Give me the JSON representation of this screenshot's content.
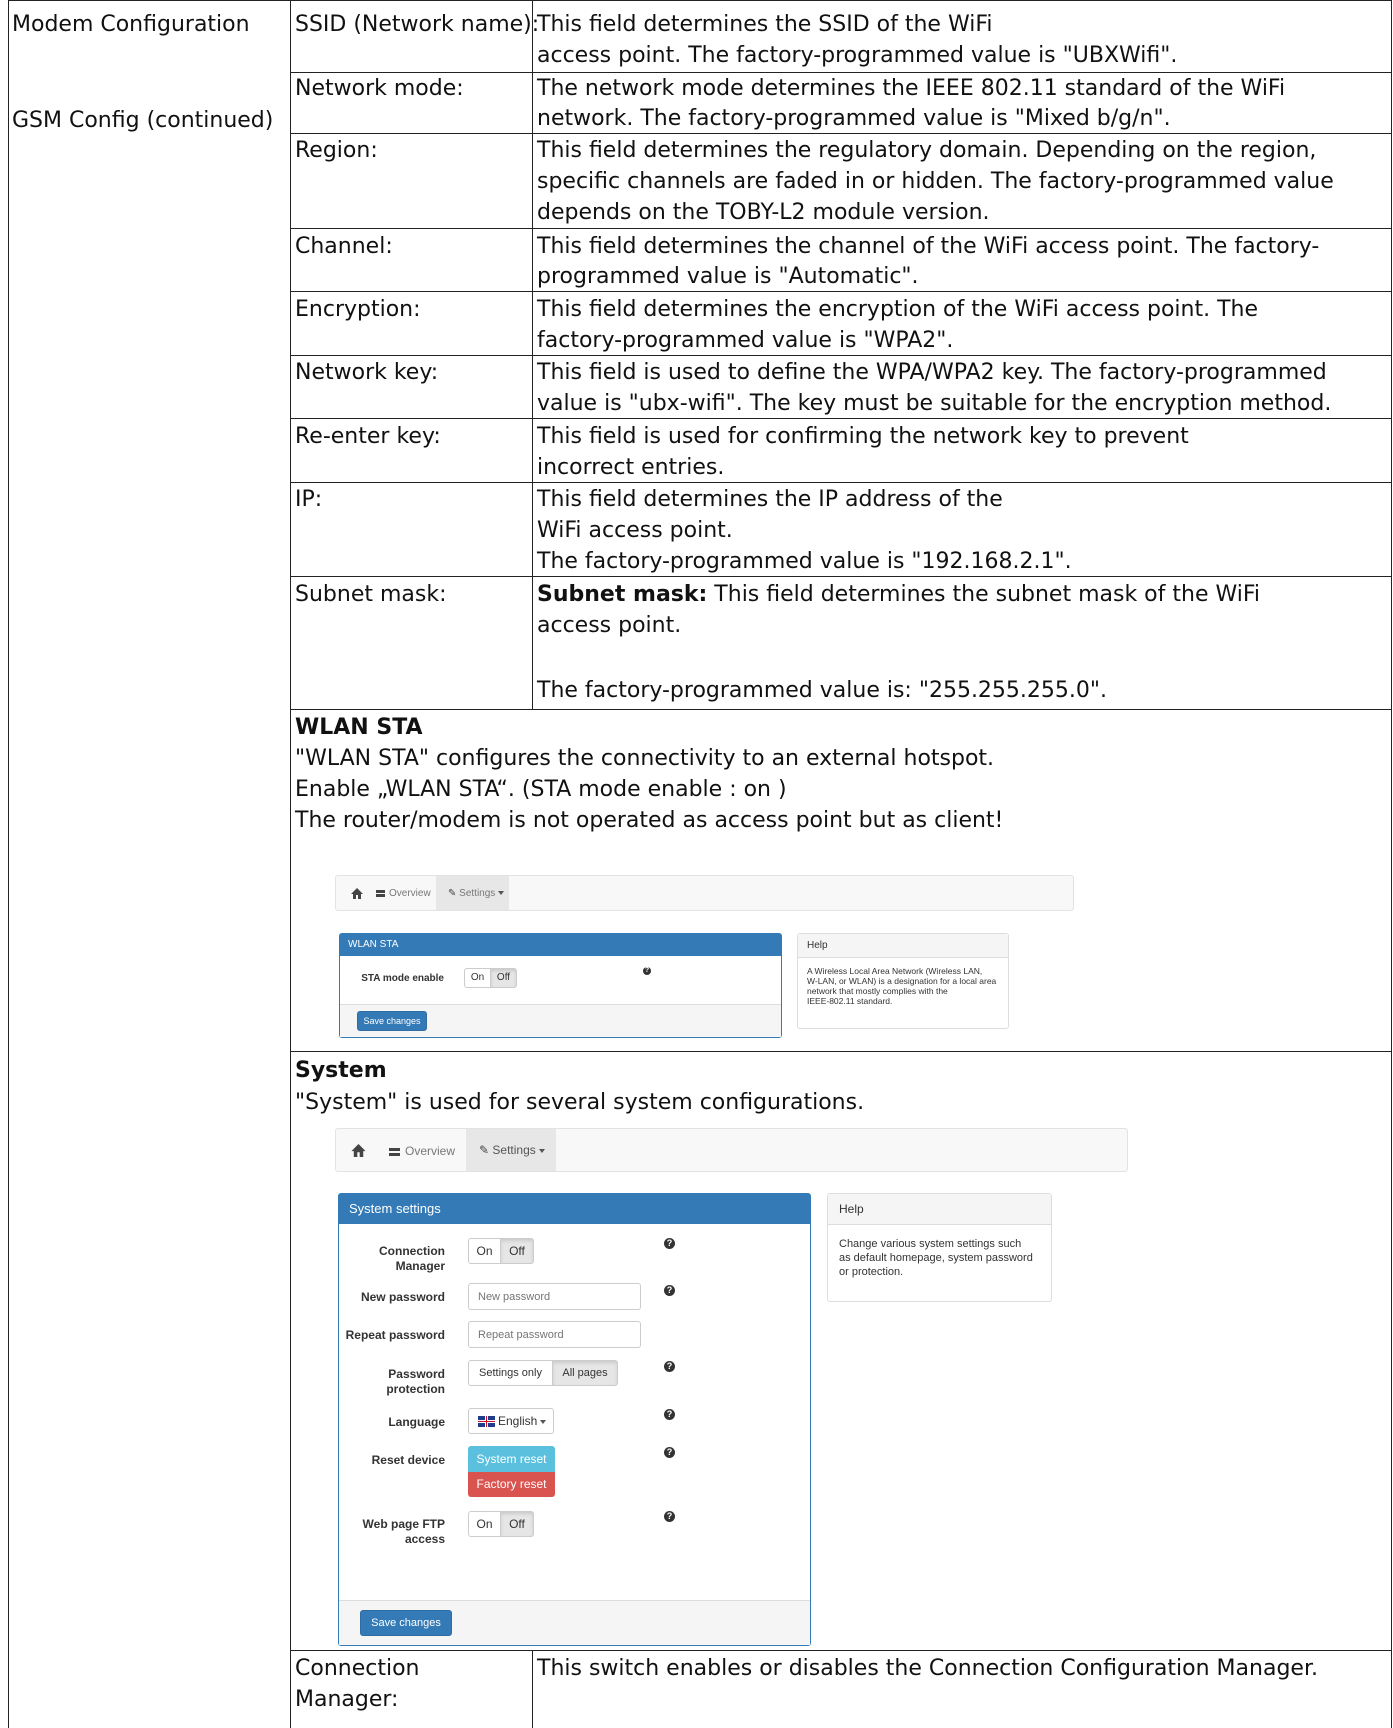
{
  "left_column": {
    "section": "Modem Configuration",
    "subsection": "GSM Config (continued)"
  },
  "wifi_rows": [
    {
      "label": "SSID (Network name):",
      "lines": [
        "This field determines the SSID of the WiFi",
        "access point. The factory-programmed value is \"UBXWifi\"."
      ]
    },
    {
      "label": "Network mode:",
      "lines": [
        "The network mode determines the IEEE 802.11 standard of the WiFi",
        "network. The factory-programmed value is \"Mixed b/g/n\"."
      ]
    },
    {
      "label": "Region:",
      "lines": [
        "This field determines the regulatory domain. Depending on the region,",
        "specific channels are faded in or hidden. The factory-programmed value",
        "depends on the TOBY-L2 module version."
      ]
    },
    {
      "label": "Channel:",
      "lines": [
        "This field determines the channel of the WiFi access point. The factory-",
        "programmed value is \"Automatic\"."
      ]
    },
    {
      "label": "Encryption:",
      "lines": [
        "This field determines the encryption of the WiFi access point. The",
        "factory-programmed value is \"WPA2\"."
      ]
    },
    {
      "label": "Network key:",
      "lines": [
        "This field is used to define the WPA/WPA2 key. The factory-programmed",
        "value is \"ubx-wifi\". The key must be suitable for the encryption method."
      ]
    },
    {
      "label": "Re-enter key:",
      "lines": [
        "This field is used for confirming the network key to prevent",
        "incorrect entries."
      ]
    },
    {
      "label": "IP:",
      "lines": [
        "This field determines the IP address of the",
        "WiFi access point.",
        "The factory-programmed value is \"192.168.2.1\"."
      ]
    }
  ],
  "subnet_row": {
    "label": "Subnet mask:",
    "bold_lead": "Subnet mask:",
    "line1": " This field determines the subnet mask of the WiFi",
    "line2": "access point.",
    "line3": "The factory-programmed value is: \"255.255.255.0\"."
  },
  "wlan_sta": {
    "heading": "WLAN STA",
    "lines": [
      "\"WLAN STA\" configures the connectivity to an external hotspot.",
      "Enable „WLAN STA“. (STA mode enable : on )",
      "The router/modem is not operated as access point but as client!"
    ],
    "screenshot": {
      "nav": {
        "overview": "Overview",
        "settings": "Settings"
      },
      "panel_title": "WLAN STA",
      "field_label": "STA mode enable",
      "toggle_on": "On",
      "toggle_off": "Off",
      "toggle_state": "Off",
      "save": "Save changes",
      "help_title": "Help",
      "help_lines": [
        "A Wireless Local Area Network (Wireless LAN,",
        "W-LAN, or WLAN) is a designation for a local area",
        "network that mostly complies with the",
        "IEEE-802.11 standard."
      ]
    }
  },
  "system": {
    "heading": "System",
    "line": "\"System\" is used for several system configurations.",
    "screenshot": {
      "nav": {
        "overview": "Overview",
        "settings": "Settings"
      },
      "panel_title": "System settings",
      "connection_manager": {
        "label1": "Connection",
        "label2": "Manager",
        "on": "On",
        "off": "Off",
        "state": "Off"
      },
      "new_password": {
        "label": "New password",
        "placeholder": "New password"
      },
      "repeat_password": {
        "label": "Repeat password",
        "placeholder": "Repeat password"
      },
      "password_protection": {
        "label1": "Password",
        "label2": "protection",
        "opt1": "Settings only",
        "opt2": "All pages",
        "state": "All pages"
      },
      "language": {
        "label": "Language",
        "value": "English"
      },
      "reset": {
        "label": "Reset device",
        "system": "System reset",
        "factory": "Factory reset"
      },
      "ftp": {
        "label1": "Web page FTP",
        "label2": "access",
        "on": "On",
        "off": "Off",
        "state": "Off"
      },
      "save": "Save changes",
      "help_title": "Help",
      "help_lines": [
        "Change various system settings such",
        "as default homepage, system password",
        "or protection."
      ]
    }
  },
  "bottom_row": {
    "label_line1": "Connection",
    "label_line2": "Manager:",
    "desc": "This switch enables or disables the Connection Configuration Manager."
  },
  "colors": {
    "primary": "#337ab7",
    "info": "#5bc0de",
    "danger": "#d9534f"
  }
}
